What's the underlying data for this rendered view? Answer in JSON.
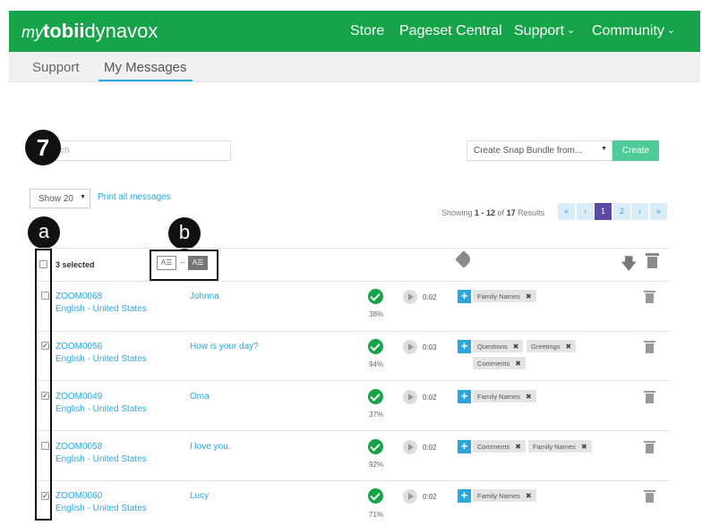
{
  "header": {
    "logo_my": "my",
    "logo_tobii": "tobii",
    "logo_dynavox": "dynavox",
    "nav": [
      {
        "label": "Store",
        "dropdown": false
      },
      {
        "label": "Pageset Central",
        "dropdown": false
      },
      {
        "label": "Support",
        "dropdown": true
      },
      {
        "label": "Community",
        "dropdown": true
      }
    ],
    "bg_color": "#17a34a"
  },
  "subnav": {
    "tabs": [
      {
        "label": "Support",
        "active": false
      },
      {
        "label": "My Messages",
        "active": true
      }
    ]
  },
  "toolbar": {
    "search_placeholder": "ch",
    "bundle_select_value": "Create Snap Bundle from...",
    "create_label": "Create",
    "show_select_value": "Show 20",
    "print_label": "Print all messages"
  },
  "pagination": {
    "showing_prefix": "Showing ",
    "range": "1 - 12",
    "of_word": " of ",
    "total": "17",
    "suffix": " Results",
    "buttons": [
      "«",
      "‹",
      "1",
      "2",
      "›",
      "»"
    ],
    "current": "1"
  },
  "callouts": {
    "seven": "7",
    "a": "a",
    "b": "b"
  },
  "table_header": {
    "selected_label": "3 selected",
    "sort_from": "A☰",
    "sort_arrow": "←",
    "sort_to": "A☰"
  },
  "rows": [
    {
      "code": "ZOOM0068",
      "language": "English - United States",
      "phrase": "Johnna",
      "checked": false,
      "score": "38%",
      "duration": "0:02",
      "tags": [
        "Family Names"
      ]
    },
    {
      "code": "ZOOM0056",
      "language": "English - United States",
      "phrase": "How is your day?",
      "checked": true,
      "score": "94%",
      "duration": "0:03",
      "tags": [
        "Questions",
        "Greetings",
        "Comments"
      ]
    },
    {
      "code": "ZOOM0049",
      "language": "English - United States",
      "phrase": "Oma",
      "checked": true,
      "score": "37%",
      "duration": "0:02",
      "tags": [
        "Family Names"
      ]
    },
    {
      "code": "ZOOM0058",
      "language": "English - United States",
      "phrase": "I love you.",
      "checked": false,
      "score": "92%",
      "duration": "0:02",
      "tags": [
        "Comments",
        "Family Names"
      ]
    },
    {
      "code": "ZOOM0060",
      "language": "English - United States",
      "phrase": "Lucy",
      "checked": true,
      "score": "71%",
      "duration": "0:02",
      "tags": [
        "Family Names"
      ]
    }
  ],
  "colors": {
    "link": "#29a8e0",
    "green": "#17a34a",
    "create": "#4ecb97",
    "pager_active": "#5b4aa3"
  }
}
